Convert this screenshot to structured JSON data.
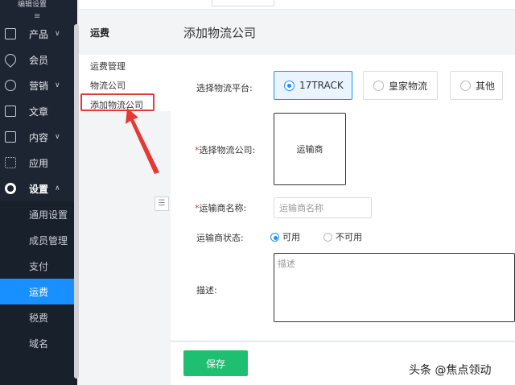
{
  "nav": {
    "top_text": "编辑设置",
    "collapse_icon": "≡",
    "items": [
      {
        "label": "产品",
        "arrow": "∨"
      },
      {
        "label": "会员",
        "arrow": ""
      },
      {
        "label": "营销",
        "arrow": "∨"
      },
      {
        "label": "文章",
        "arrow": ""
      },
      {
        "label": "内容",
        "arrow": "∨"
      },
      {
        "label": "应用",
        "arrow": ""
      },
      {
        "label": "设置",
        "arrow": "∧"
      }
    ],
    "subitems": [
      {
        "label": "通用设置"
      },
      {
        "label": "成员管理"
      },
      {
        "label": "支付"
      },
      {
        "label": "运费"
      },
      {
        "label": "税费"
      },
      {
        "label": "域名"
      }
    ]
  },
  "menu2": {
    "title": "运费",
    "items": [
      "运费管理",
      "物流公司",
      "添加物流公司"
    ],
    "fold_icon": "☰"
  },
  "main": {
    "title": "添加物流公司",
    "platform_label": "选择物流平台:",
    "platform_options": [
      "17TRACK",
      "皇家物流",
      "其他"
    ],
    "carrier_label": "选择物流公司:",
    "carrier_box_text": "运输商",
    "name_label": "运输商名称:",
    "name_placeholder": "运输商名称",
    "status_label": "运输商状态:",
    "status_options": [
      "可用",
      "不可用"
    ],
    "desc_label": "描述:",
    "desc_placeholder": "描述",
    "required_mark": "*"
  },
  "footer": {
    "save_label": "保存",
    "watermark": "头条 @焦点领动"
  },
  "colors": {
    "nav_bg": "#1d2533",
    "primary": "#1890ff",
    "save_green": "#1fbf72",
    "annotation_red": "#e53935"
  }
}
